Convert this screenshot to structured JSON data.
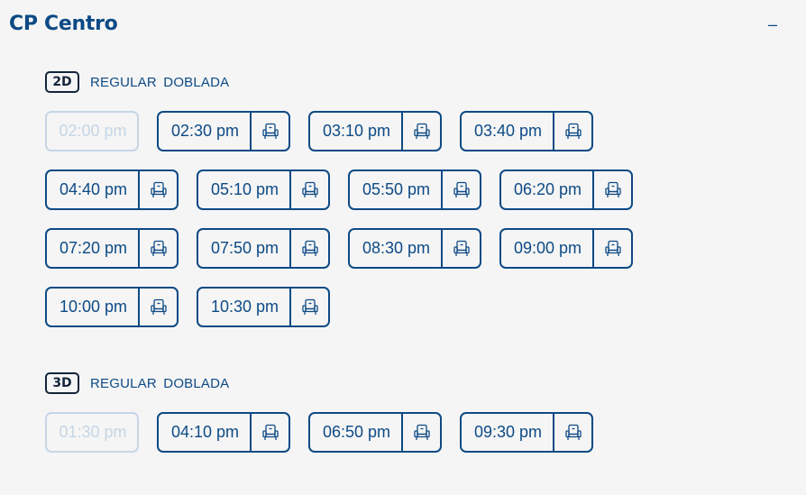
{
  "cinema": {
    "name": "CP Centro",
    "collapse_symbol": "–"
  },
  "sections": [
    {
      "format": "2D",
      "description": "REGULAR DOBLADA",
      "showtimes": [
        {
          "time": "02:00 pm",
          "available": false
        },
        {
          "time": "02:30 pm",
          "available": true
        },
        {
          "time": "03:10 pm",
          "available": true
        },
        {
          "time": "03:40 pm",
          "available": true
        },
        {
          "time": "04:40 pm",
          "available": true
        },
        {
          "time": "05:10 pm",
          "available": true
        },
        {
          "time": "05:50 pm",
          "available": true
        },
        {
          "time": "06:20 pm",
          "available": true
        },
        {
          "time": "07:20 pm",
          "available": true
        },
        {
          "time": "07:50 pm",
          "available": true
        },
        {
          "time": "08:30 pm",
          "available": true
        },
        {
          "time": "09:00 pm",
          "available": true
        },
        {
          "time": "10:00 pm",
          "available": true
        },
        {
          "time": "10:30 pm",
          "available": true
        }
      ]
    },
    {
      "format": "3D",
      "description": "REGULAR DOBLADA",
      "showtimes": [
        {
          "time": "01:30 pm",
          "available": false
        },
        {
          "time": "04:10 pm",
          "available": true
        },
        {
          "time": "06:50 pm",
          "available": true
        },
        {
          "time": "09:30 pm",
          "available": true
        }
      ]
    }
  ],
  "icons": {
    "seat": "seat-icon",
    "collapse": "minus-icon"
  },
  "colors": {
    "primary": "#0d4a85",
    "disabled": "#c6d6e6",
    "badge": "#14253a",
    "background": "#f5f5f5"
  }
}
